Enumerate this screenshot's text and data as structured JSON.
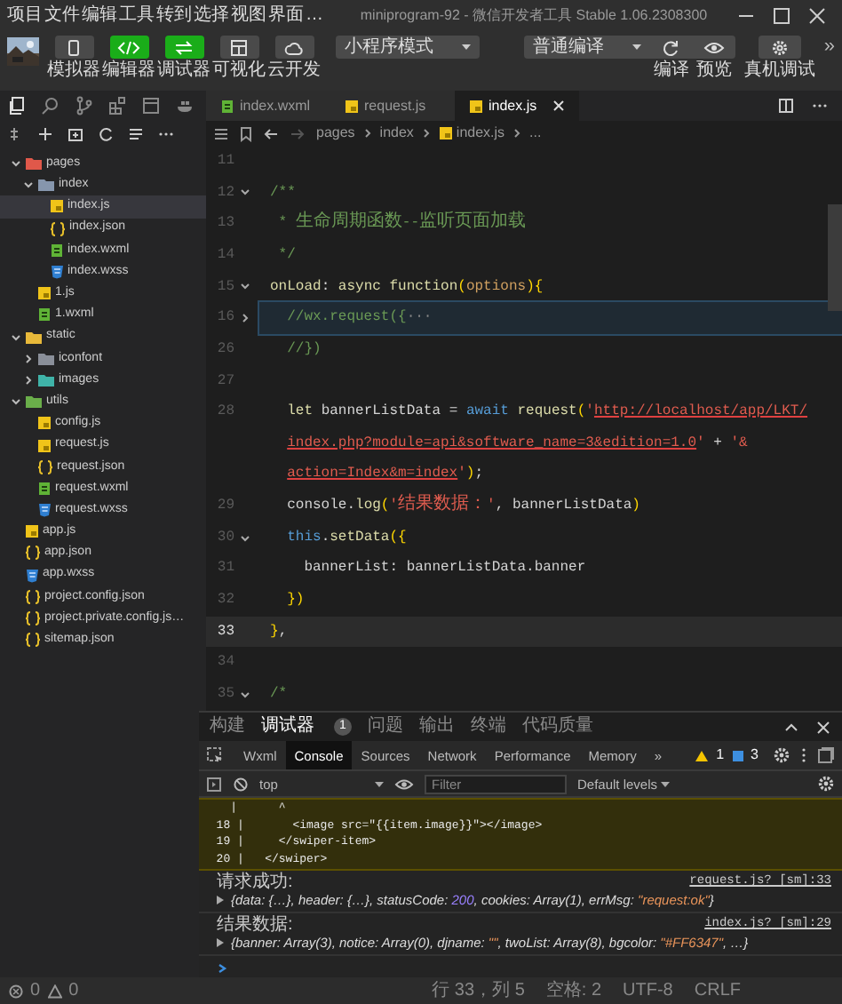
{
  "menu": [
    "项目",
    "文件",
    "编辑",
    "工具",
    "转到",
    "选择",
    "视图",
    "界面",
    "…"
  ],
  "window": {
    "title": "miniprogram-92 - 微信开发者工具 Stable 1.06.2308300"
  },
  "toolbar": {
    "buttons": [
      {
        "kind": "phone",
        "label": "模拟器",
        "on": false
      },
      {
        "kind": "code",
        "label": "编辑器",
        "on": true
      },
      {
        "kind": "debug",
        "label": "调试器",
        "on": true
      },
      {
        "kind": "layout",
        "label": "可视化",
        "on": false
      },
      {
        "kind": "cloud",
        "label": "云开发",
        "on": false
      }
    ],
    "mode": "小程序模式",
    "compile": "普通编译",
    "actions": [
      {
        "kind": "refresh",
        "label": "编译"
      },
      {
        "kind": "eye",
        "label": "预览"
      },
      {
        "kind": "gear",
        "label": "真机调试"
      }
    ],
    "more": "»"
  },
  "tabs": [
    {
      "kind": "wxml",
      "label": "index.wxml",
      "selected": false
    },
    {
      "kind": "js",
      "label": "request.js",
      "selected": false
    },
    {
      "kind": "js",
      "label": "index.js",
      "selected": true
    }
  ],
  "breadcrumb": [
    {
      "kind": "folder",
      "label": "pages"
    },
    {
      "kind": "folder",
      "label": "index"
    },
    {
      "kind": "js",
      "label": "index.js"
    },
    {
      "kind": "more",
      "label": "..."
    }
  ],
  "tree": [
    {
      "kind": "folder",
      "label": "pages",
      "color": "#e0584a",
      "expanded": true,
      "selected": false,
      "children": [
        {
          "kind": "folder",
          "label": "index",
          "color": "#8696ad",
          "expanded": true,
          "selected": false,
          "children": [
            {
              "kind": "js",
              "label": "index.js",
              "selected": true
            },
            {
              "kind": "json",
              "label": "index.json",
              "selected": false
            },
            {
              "kind": "wxml",
              "label": "index.wxml",
              "selected": false
            },
            {
              "kind": "wxss",
              "label": "index.wxss",
              "selected": false
            }
          ]
        },
        {
          "kind": "js",
          "label": "1.js",
          "selected": false
        },
        {
          "kind": "wxml",
          "label": "1.wxml",
          "selected": false
        }
      ]
    },
    {
      "kind": "folder",
      "label": "static",
      "color": "#e8b93a",
      "expanded": true,
      "selected": false,
      "children": [
        {
          "kind": "folder",
          "label": "iconfont",
          "color": "#8a8f99",
          "expanded": false,
          "selected": false
        },
        {
          "kind": "folder",
          "label": "images",
          "color": "#3fb3a8",
          "expanded": false,
          "selected": false
        }
      ]
    },
    {
      "kind": "folder",
      "label": "utils",
      "color": "#6aae4a",
      "expanded": true,
      "selected": false,
      "children": [
        {
          "kind": "js",
          "label": "config.js",
          "selected": false
        },
        {
          "kind": "js",
          "label": "request.js",
          "selected": false
        },
        {
          "kind": "json",
          "label": "request.json",
          "selected": false
        },
        {
          "kind": "wxml",
          "label": "request.wxml",
          "selected": false
        },
        {
          "kind": "wxss",
          "label": "request.wxss",
          "selected": false
        }
      ]
    },
    {
      "kind": "js",
      "label": "app.js",
      "selected": false
    },
    {
      "kind": "json",
      "label": "app.json",
      "selected": false
    },
    {
      "kind": "wxss",
      "label": "app.wxss",
      "selected": false
    },
    {
      "kind": "json",
      "label": "project.config.json",
      "selected": false
    },
    {
      "kind": "json",
      "label": "project.private.config.js…",
      "selected": false
    },
    {
      "kind": "json",
      "label": "sitemap.json",
      "selected": false
    }
  ],
  "editor": {
    "lines": [
      {
        "number": "11",
        "current": false,
        "highlighted": false
      },
      {
        "number": "12",
        "expanded": true,
        "current": false,
        "highlighted": false,
        "wrapped": false,
        "tokens": [
          {
            "kind": "comment",
            "text": "/**"
          }
        ]
      },
      {
        "number": "13",
        "current": false,
        "highlighted": false,
        "wrapped": false,
        "tokens": [
          {
            "kind": "comment",
            "text": " * 生命周期函数--监听页面加载"
          }
        ]
      },
      {
        "number": "14",
        "current": false,
        "highlighted": false,
        "wrapped": false,
        "tokens": [
          {
            "kind": "comment",
            "text": " */"
          }
        ]
      },
      {
        "number": "15",
        "expanded": true,
        "current": false,
        "highlighted": false,
        "wrapped": false,
        "tokens": [
          {
            "kind": "func",
            "text": "onLoad"
          },
          {
            "kind": "plain",
            "text": ": "
          },
          {
            "kind": "func",
            "text": "async function"
          },
          {
            "kind": "bracket",
            "text": "("
          },
          {
            "kind": "param",
            "text": "options"
          },
          {
            "kind": "bracket",
            "text": "){"
          }
        ]
      },
      {
        "number": "16",
        "expanded": false,
        "current": false,
        "highlighted": true,
        "wrapped": false,
        "tokens": [
          {
            "kind": "comment",
            "text": "  //wx.request({"
          },
          {
            "kind": "ellipsis",
            "text": "···"
          }
        ]
      },
      {
        "number": "26",
        "current": false,
        "highlighted": false,
        "wrapped": false,
        "tokens": [
          {
            "kind": "comment",
            "text": "  //})"
          }
        ]
      },
      {
        "number": "27",
        "current": false,
        "highlighted": false
      },
      {
        "number": "28",
        "current": false,
        "highlighted": false,
        "wrapped": false,
        "tokens": [
          {
            "kind": "func",
            "text": "  let"
          },
          {
            "kind": "plain",
            "text": " bannerListData = "
          },
          {
            "kind": "blue",
            "text": "await"
          },
          {
            "kind": "func",
            "text": " request"
          },
          {
            "kind": "bracket",
            "text": "("
          },
          {
            "kind": "string",
            "text": "'"
          },
          {
            "kind": "link",
            "text": "http://localhost/app/LKT/"
          }
        ]
      },
      {
        "current": false,
        "highlighted": false,
        "wrapped": true,
        "tokens": [
          {
            "kind": "link",
            "text": "index.php?module=api&software_name=3&edition=1.0"
          },
          {
            "kind": "string",
            "text": "'"
          },
          {
            "kind": "plain",
            "text": " + "
          },
          {
            "kind": "string",
            "text": "'&"
          }
        ]
      },
      {
        "current": false,
        "highlighted": false,
        "wrapped": true,
        "tokens": [
          {
            "kind": "link",
            "text": "action=Index&m=index"
          },
          {
            "kind": "string",
            "text": "'"
          },
          {
            "kind": "bracket",
            "text": ")"
          },
          {
            "kind": "plain",
            "text": ";"
          }
        ]
      },
      {
        "number": "29",
        "current": false,
        "highlighted": false,
        "wrapped": false,
        "tokens": [
          {
            "kind": "plain",
            "text": "  console."
          },
          {
            "kind": "func",
            "text": "log"
          },
          {
            "kind": "bracket",
            "text": "("
          },
          {
            "kind": "string",
            "text": "'结果数据：'"
          },
          {
            "kind": "plain",
            "text": ", bannerListData"
          },
          {
            "kind": "bracket",
            "text": ")"
          }
        ]
      },
      {
        "number": "30",
        "expanded": true,
        "current": false,
        "highlighted": false,
        "wrapped": false,
        "tokens": [
          {
            "kind": "blue",
            "text": "  this"
          },
          {
            "kind": "plain",
            "text": "."
          },
          {
            "kind": "func",
            "text": "setData"
          },
          {
            "kind": "bracket",
            "text": "({"
          }
        ]
      },
      {
        "number": "31",
        "current": false,
        "highlighted": false,
        "wrapped": false,
        "tokens": [
          {
            "kind": "plain",
            "text": "    bannerList: bannerListData.banner"
          }
        ]
      },
      {
        "number": "32",
        "current": false,
        "highlighted": false,
        "wrapped": false,
        "tokens": [
          {
            "kind": "bracket",
            "text": "  })"
          }
        ]
      },
      {
        "number": "33",
        "current": true,
        "highlighted": false,
        "wrapped": false,
        "tokens": [
          {
            "kind": "bracket",
            "text": "}"
          },
          {
            "kind": "plain",
            "text": ","
          }
        ]
      },
      {
        "number": "34",
        "current": false,
        "highlighted": false
      },
      {
        "number": "35",
        "expanded": true,
        "current": false,
        "highlighted": false,
        "wrapped": false,
        "tokens": [
          {
            "kind": "comment",
            "text": "/*"
          }
        ]
      }
    ]
  },
  "panel": {
    "tabs": [
      {
        "label": "构建",
        "selected": false
      },
      {
        "label": "调试器",
        "selected": true,
        "badge": "1"
      },
      {
        "label": "问题",
        "selected": false
      },
      {
        "label": "输出",
        "selected": false
      },
      {
        "label": "终端",
        "selected": false
      },
      {
        "label": "代码质量",
        "selected": false
      }
    ],
    "devtools_tabs": [
      {
        "label": "Wxml",
        "selected": false
      },
      {
        "label": "Console",
        "selected": true
      },
      {
        "label": "Sources",
        "selected": false
      },
      {
        "label": "Network",
        "selected": false
      },
      {
        "label": "Performance",
        "selected": false
      },
      {
        "label": "Memory",
        "selected": false
      }
    ],
    "more": "»",
    "warnings": "1",
    "messages": "3",
    "context": "top",
    "filter": {
      "placeholder": "Filter"
    },
    "levels": "Default levels",
    "code_frame": [
      "    |      ^",
      "  18 |       <image src=\"{{item.image}}\"></image>",
      "  19 |     </swiper-item>",
      "  20 |   </swiper>"
    ],
    "logs": [
      {
        "label": "请求成功:",
        "source": "request.js? [sm]:33",
        "preview": [
          {
            "kind": "plain",
            "text": "{data: {…}, header: {…}, statusCode: "
          },
          {
            "kind": "number",
            "text": "200"
          },
          {
            "kind": "plain",
            "text": ", cookies: Array(1), errMsg: "
          },
          {
            "kind": "string",
            "text": "\"request:ok\""
          },
          {
            "kind": "plain",
            "text": "}"
          }
        ]
      },
      {
        "label": "结果数据:",
        "source": "index.js? [sm]:29",
        "preview": [
          {
            "kind": "plain",
            "text": "{banner: Array(3), notice: Array(0), djname: "
          },
          {
            "kind": "string",
            "text": "\"\""
          },
          {
            "kind": "plain",
            "text": ", twoList: Array(8), bgcolor: "
          },
          {
            "kind": "string",
            "text": "\"#FF6347\""
          },
          {
            "kind": "plain",
            "text": ", …}"
          }
        ]
      }
    ]
  },
  "status_bar": {
    "errors": "0",
    "warnings": "0",
    "position": "行 33，列 5",
    "indent": "空格: 2",
    "encoding": "UTF-8",
    "eol": "CRLF"
  }
}
